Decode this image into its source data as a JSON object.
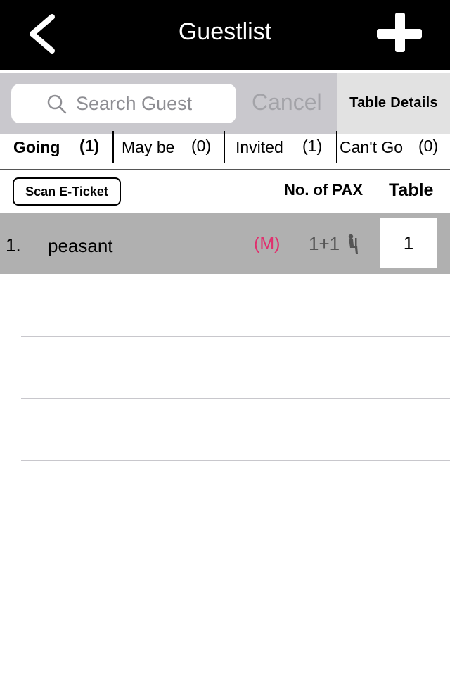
{
  "header": {
    "title": "Guestlist",
    "back_icon": "chevron-left-icon",
    "add_icon": "plus-icon"
  },
  "search": {
    "placeholder": "Search Guest",
    "value": "",
    "cancel_label": "Cancel",
    "icon": "search-icon"
  },
  "table_details_label": "Table Details",
  "tabs": [
    {
      "label": "Going",
      "count": "(1)",
      "selected": true
    },
    {
      "label": "May be",
      "count": "(0)",
      "selected": false
    },
    {
      "label": "Invited",
      "count": "(1)",
      "selected": false
    },
    {
      "label": "Can't Go",
      "count": "(0)",
      "selected": false
    }
  ],
  "columns": {
    "scan_label": "Scan E-Ticket",
    "pax_label": "No. of PAX",
    "table_label": "Table"
  },
  "guests": [
    {
      "index": "1.",
      "name": "peasant",
      "gender": "(M)",
      "pax": "1+1",
      "pax_icon": "person-seated-icon",
      "table": "1"
    }
  ],
  "colors": {
    "header_bg": "#000000",
    "search_bar_bg": "#c9c8cd",
    "row_highlight": "#b0b0b0",
    "gender_male": "#e0306e",
    "table_details_bg": "#e2e2e2"
  }
}
